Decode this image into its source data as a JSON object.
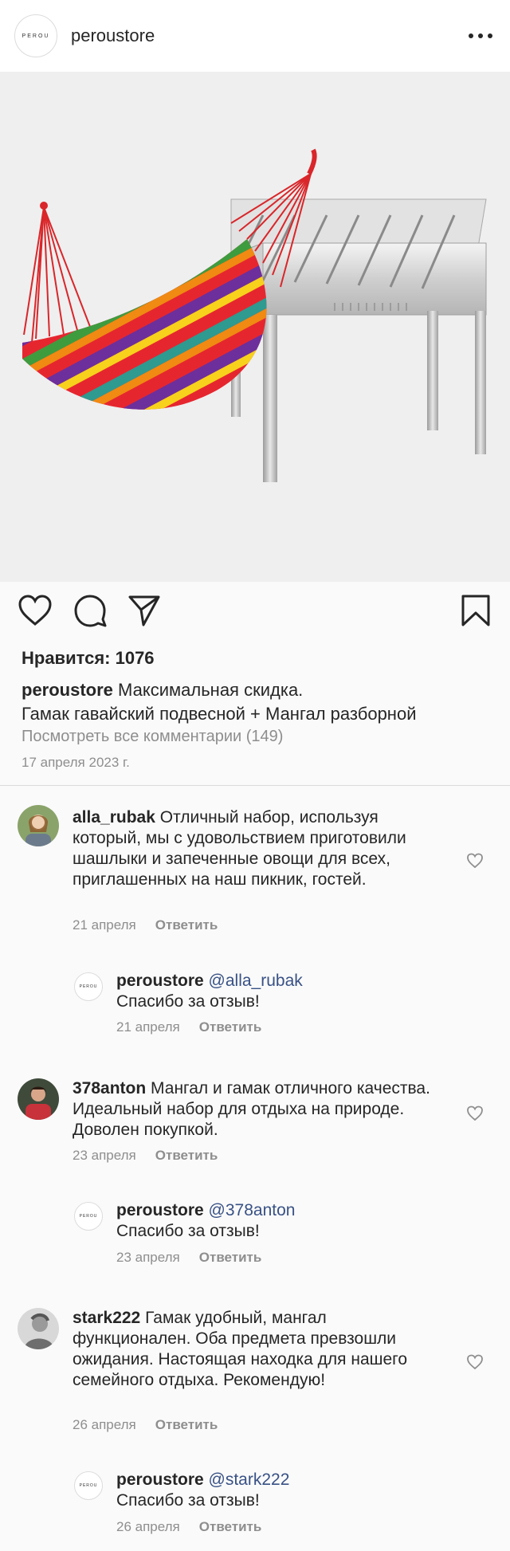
{
  "header": {
    "logo_text": "PEROU",
    "username": "peroustore",
    "more_icon": "more-horizontal-icon"
  },
  "post": {
    "image_alt": "hammock-and-grill-product-photo",
    "likes_label": "Нравится: 1076",
    "caption_username": "peroustore",
    "caption_line1": "Максимальная скидка.",
    "caption_line2": "Гамак гавайский подвесной + Мангал разборной",
    "view_all_comments": "Посмотреть все комментарии (149)",
    "date": "17 апреля 2023 г."
  },
  "actions": {
    "like_icon": "heart-icon",
    "comment_icon": "comment-icon",
    "share_icon": "send-icon",
    "save_icon": "bookmark-icon"
  },
  "comments": [
    {
      "username": "alla_rubak",
      "text": "Отличный набор, используя который, мы с удовольствием приготовили шашлыки и запеченные овощи для всех, приглашенных на наш пикник, гостей.",
      "date": "21 апреля",
      "reply_label": "Ответить",
      "reply": {
        "username": "peroustore",
        "mention": "@alla_rubak",
        "text": "Спасибо за отзыв!",
        "date": "21 апреля",
        "reply_label": "Ответить"
      }
    },
    {
      "username": "378anton",
      "text": "Мангал и гамак отличного качества. Идеальный набор для отдыха на природе. Доволен покупкой.",
      "date": "23 апреля",
      "reply_label": "Ответить",
      "reply": {
        "username": "peroustore",
        "mention": "@378anton",
        "text": "Спасибо за отзыв!",
        "date": "23 апреля",
        "reply_label": "Ответить"
      }
    },
    {
      "username": "stark222",
      "text": "Гамак удобный, мангал функционален. Оба предмета превзошли ожидания. Настоящая находка для нашего семейного отдыха. Рекомендую!",
      "date": "26 апреля",
      "reply_label": "Ответить",
      "reply": {
        "username": "peroustore",
        "mention": "@stark222",
        "text": "Спасибо за отзыв!",
        "date": "26 апреля",
        "reply_label": "Ответить"
      }
    }
  ],
  "colors": {
    "background": "#fafafa",
    "text": "#262626",
    "muted": "#8e8e8e",
    "mention": "#385185"
  }
}
